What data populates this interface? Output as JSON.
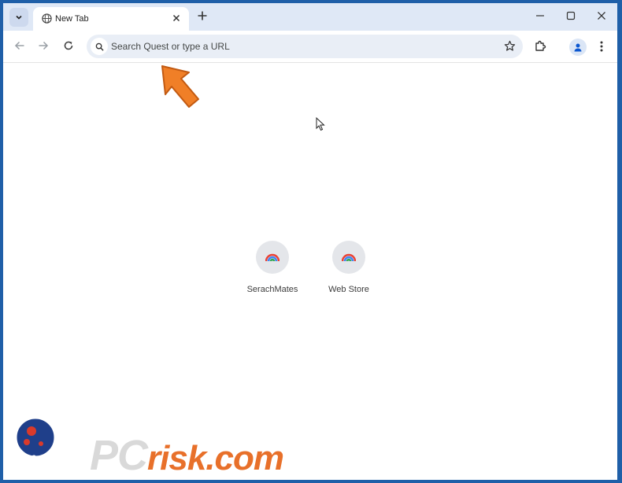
{
  "browser": {
    "tab": {
      "title": "New Tab"
    },
    "omnibox": {
      "placeholder": "Search Quest or type a URL"
    }
  },
  "shortcuts": [
    {
      "label": "SerachMates"
    },
    {
      "label": "Web Store"
    }
  ],
  "watermark": {
    "brand_a": "PC",
    "brand_b": "risk.com"
  },
  "colors": {
    "accent": "#e8702a",
    "frame": "#1f5fa8",
    "tabstrip": "#dfe8f6"
  }
}
